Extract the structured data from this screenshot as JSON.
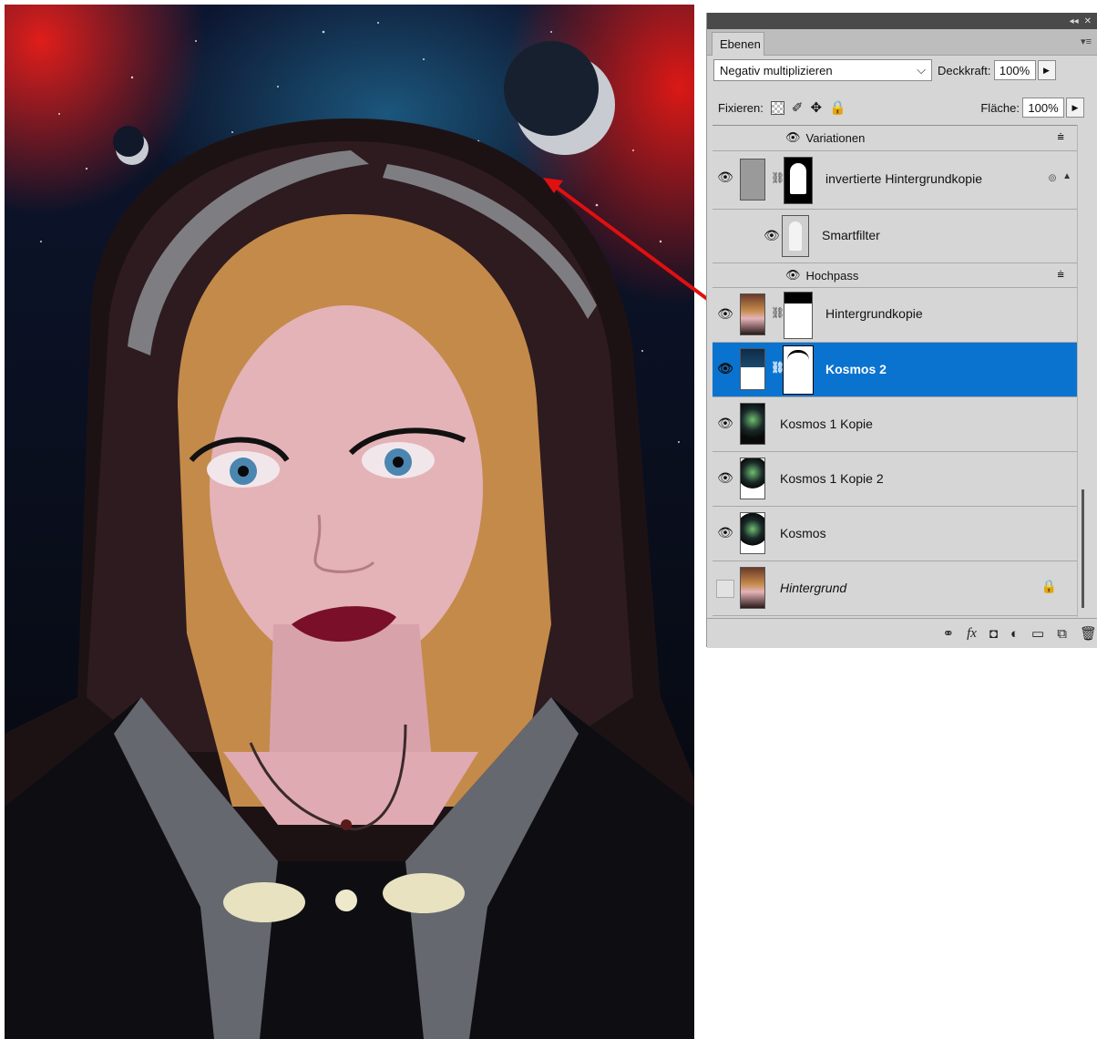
{
  "panel": {
    "tab_label": "Ebenen",
    "blend_mode": "Negativ multiplizieren",
    "opacity_label": "Deckkraft:",
    "opacity_value": "100%",
    "lock_label": "Fixieren:",
    "fill_label": "Fläche:",
    "fill_value": "100%"
  },
  "layers": [
    {
      "name": "Variationen",
      "kind": "filter-effect"
    },
    {
      "name": "invertierte Hintergrundkopie",
      "kind": "smart-object",
      "visible": true
    },
    {
      "name": "Smartfilter",
      "kind": "smart-filter"
    },
    {
      "name": "Hochpass",
      "kind": "filter-effect"
    },
    {
      "name": "Hintergrundkopie",
      "kind": "layer-with-mask",
      "visible": true
    },
    {
      "name": "Kosmos 2",
      "kind": "layer-with-mask",
      "visible": true,
      "selected": true
    },
    {
      "name": "Kosmos 1 Kopie",
      "kind": "layer",
      "visible": true
    },
    {
      "name": "Kosmos 1 Kopie 2",
      "kind": "layer",
      "visible": true
    },
    {
      "name": "Kosmos",
      "kind": "layer",
      "visible": true
    },
    {
      "name": "Hintergrund",
      "kind": "background",
      "visible": false,
      "locked": true
    }
  ],
  "footer_icons": [
    "link-icon",
    "fx-icon",
    "add-mask-icon",
    "adjustment-icon",
    "group-icon",
    "new-layer-icon",
    "trash-icon"
  ],
  "colors": {
    "selection": "#0a73cf",
    "panel_bg": "#d6d6d6",
    "arrow": "#e01010"
  }
}
